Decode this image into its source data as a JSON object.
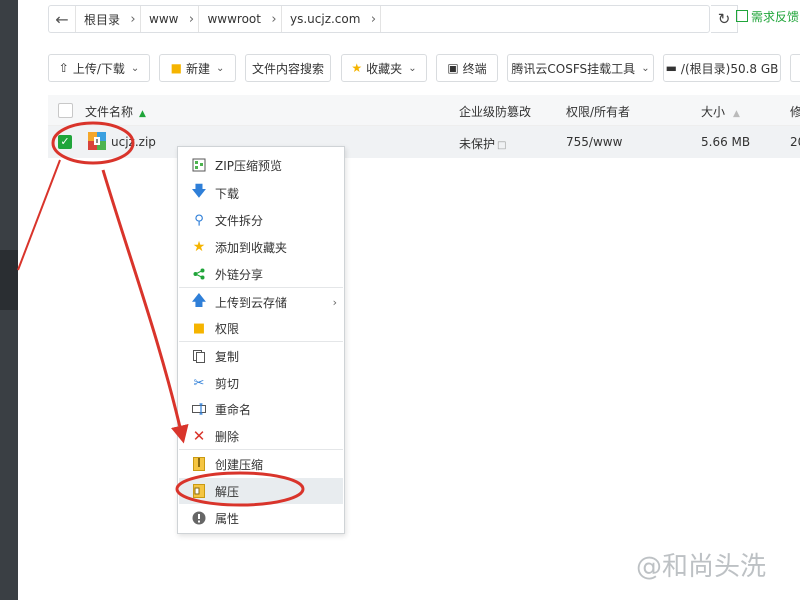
{
  "address_bar": {
    "crumbs": [
      "根目录",
      "www",
      "wwwroot",
      "ys.ucjz.com"
    ],
    "feedback_label": "需求反馈"
  },
  "toolbar": {
    "upload_download": "上传/下载",
    "new": "新建",
    "content_search": "文件内容搜索",
    "favorites": "收藏夹",
    "terminal": "终端",
    "cosfs": "腾讯云COSFS挂载工具",
    "disk": "/(根目录)50.8 GB"
  },
  "table": {
    "headers": {
      "name": "文件名称",
      "protect": "企业级防篡改",
      "perm": "权限/所有者",
      "size": "大小",
      "modified": "修"
    },
    "rows": [
      {
        "name": "ucjz.zip",
        "protect": "未保护",
        "perm": "755/www",
        "size": "5.66 MB",
        "modified": "20"
      }
    ]
  },
  "context_menu": {
    "items": [
      {
        "label": "ZIP压缩预览",
        "icon": "zip-preview-icon"
      },
      {
        "label": "下载",
        "icon": "download-icon"
      },
      {
        "label": "文件拆分",
        "icon": "split-icon"
      },
      {
        "label": "添加到收藏夹",
        "icon": "star-icon"
      },
      {
        "label": "外链分享",
        "icon": "share-icon"
      },
      {
        "label": "上传到云存储",
        "icon": "upload-cloud-icon"
      },
      {
        "label": "权限",
        "icon": "permission-icon"
      },
      {
        "label": "复制",
        "icon": "copy-icon"
      },
      {
        "label": "剪切",
        "icon": "cut-icon"
      },
      {
        "label": "重命名",
        "icon": "rename-icon"
      },
      {
        "label": "删除",
        "icon": "delete-icon"
      },
      {
        "label": "创建压缩",
        "icon": "compress-icon"
      },
      {
        "label": "解压",
        "icon": "extract-icon"
      },
      {
        "label": "属性",
        "icon": "info-icon"
      }
    ]
  },
  "watermark": "@和尚头洗",
  "colors": {
    "accent_green": "#20a53a",
    "annotation_red": "#d9342b",
    "row_highlight": "#f0f2f4"
  }
}
